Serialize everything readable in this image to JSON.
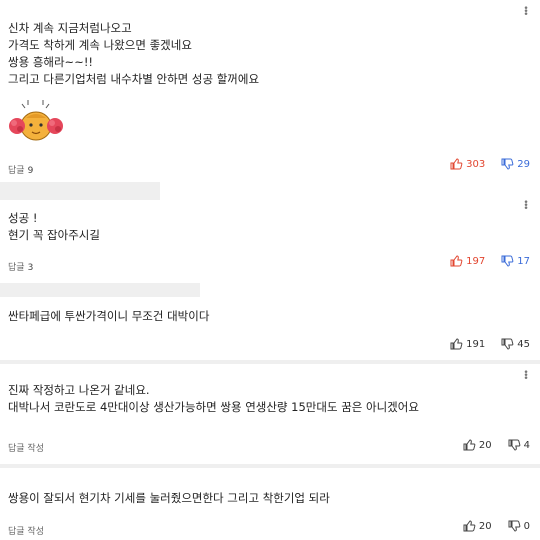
{
  "comments": [
    {
      "lines": [
        "신차 계속 지금처럼나오고",
        "가격도 착하게 계속 나왔으면 좋겠네요",
        "쌍용 흥해라~~!!",
        "그리고 다른기업처럼 내수차별 안하면 성공 할꺼에요"
      ],
      "reply_label": "답글",
      "reply_count": "9",
      "likes": "303",
      "dislikes": "29",
      "has_sticker": true
    },
    {
      "lines": [
        "성공 !",
        "현기 꼭 잡아주시길"
      ],
      "reply_label": "답글",
      "reply_count": "3",
      "likes": "197",
      "dislikes": "17"
    },
    {
      "lines": [
        "싼타페급에 투싼가격이니 무조건 대박이다"
      ],
      "reply_label": "",
      "reply_count": "",
      "likes": "191",
      "dislikes": "45"
    },
    {
      "lines": [
        "진짜 작정하고 나온거 같네요.",
        "대박나서 코란도로 4만대이상 생산가능하면 쌍용 연생산량 15만대도 꿈은 아니겠어요"
      ],
      "reply_label": "답글 작성",
      "reply_count": "",
      "likes": "20",
      "dislikes": "4"
    },
    {
      "lines": [
        "쌍용이 잘되서 현기차 기세를 눌러줬으면한다 그리고 착한기업 되라"
      ],
      "reply_label": "답글 작성",
      "reply_count": "",
      "likes": "20",
      "dislikes": "0"
    }
  ],
  "colors": {
    "like": "#e2452f",
    "dislike": "#3a6bd8",
    "text": "#222222"
  },
  "icons": {
    "more": "more-vertical-icon",
    "like": "thumbs-up-icon",
    "dislike": "thumbs-down-icon",
    "sticker": "cheering-character-sticker"
  }
}
